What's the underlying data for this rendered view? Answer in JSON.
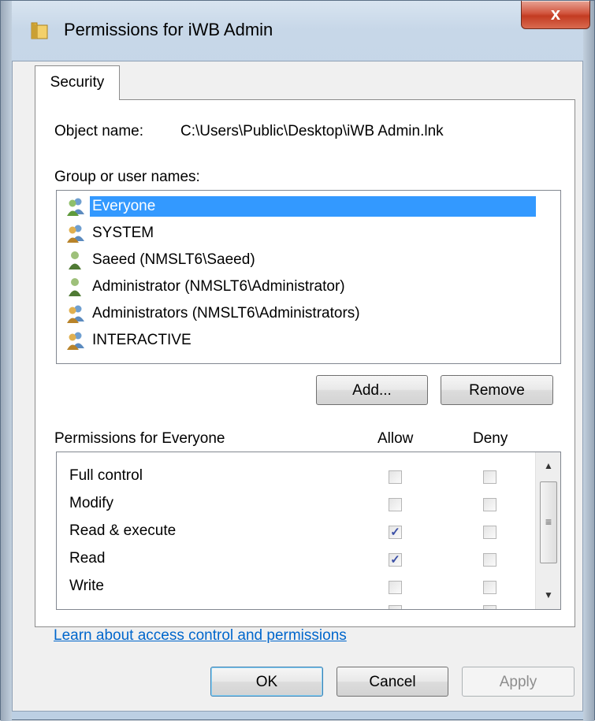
{
  "window": {
    "title": "Permissions for iWB Admin",
    "close_label": "x"
  },
  "tabs": [
    {
      "label": "Security"
    }
  ],
  "security": {
    "object_name_label": "Object name:",
    "object_name_value": "C:\\Users\\Public\\Desktop\\iWB Admin.lnk",
    "group_label": "Group or user names:",
    "users": [
      {
        "name": "Everyone",
        "icon": "group-icon",
        "selected": true
      },
      {
        "name": "SYSTEM",
        "icon": "group-icon",
        "selected": false
      },
      {
        "name": "Saeed (NMSLT6\\Saeed)",
        "icon": "user-icon",
        "selected": false
      },
      {
        "name": "Administrator (NMSLT6\\Administrator)",
        "icon": "user-icon",
        "selected": false
      },
      {
        "name": "Administrators (NMSLT6\\Administrators)",
        "icon": "group-icon",
        "selected": false
      },
      {
        "name": "INTERACTIVE",
        "icon": "group-icon",
        "selected": false
      }
    ],
    "add_label": "Add...",
    "remove_label": "Remove",
    "permissions_label": "Permissions for Everyone",
    "allow_label": "Allow",
    "deny_label": "Deny",
    "permissions": [
      {
        "name": "Full control",
        "allow": false,
        "deny": false
      },
      {
        "name": "Modify",
        "allow": false,
        "deny": false
      },
      {
        "name": "Read & execute",
        "allow": true,
        "deny": false
      },
      {
        "name": "Read",
        "allow": true,
        "deny": false
      },
      {
        "name": "Write",
        "allow": false,
        "deny": false
      }
    ],
    "learn_link": "Learn about access control and permissions"
  },
  "footer": {
    "ok_label": "OK",
    "cancel_label": "Cancel",
    "apply_label": "Apply"
  },
  "colors": {
    "selection": "#3399ff",
    "link": "#0066cc",
    "close_button": "#c33b22"
  }
}
